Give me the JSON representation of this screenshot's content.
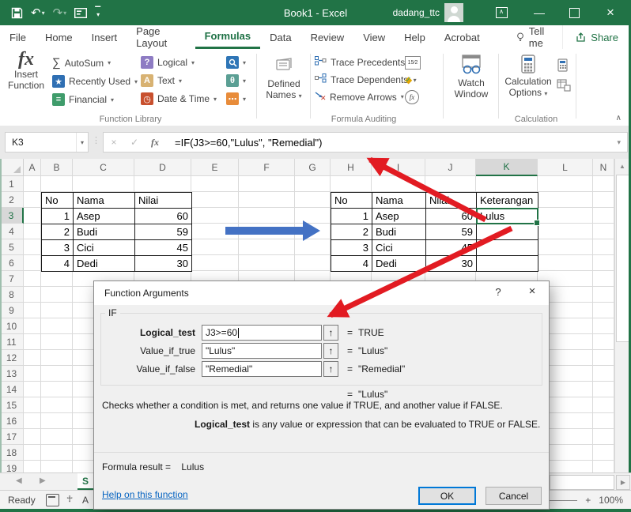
{
  "titlebar": {
    "title": "Book1 - Excel",
    "user": "dadang_ttc"
  },
  "icons": {
    "dropdown": "▾",
    "collapse_field": "↑",
    "collapse_ribbon": "∧",
    "close": "×",
    "minimize": "—",
    "help": "?",
    "undo": "↶",
    "redo": "↷",
    "sigma": "∑",
    "cancel_x": "×",
    "check": "✓",
    "fx": "fx",
    "up_scroll": "▲",
    "right_scroll": "▶",
    "left_nav": "◀",
    "right_nav": "▶",
    "plus": "+",
    "qat_chevron": "▾",
    "vdots": "⋮"
  },
  "tabs": {
    "items": [
      "File",
      "Home",
      "Insert",
      "Page Layout",
      "Formulas",
      "Data",
      "Review",
      "View",
      "Help",
      "Acrobat"
    ],
    "active": "Formulas",
    "tell_me": "Tell me",
    "share": "Share"
  },
  "ribbon": {
    "insert_function": "Insert Function",
    "autosum": "AutoSum",
    "recently_used": "Recently Used",
    "financial": "Financial",
    "logical": "Logical",
    "text": "Text",
    "date_time": "Date & Time",
    "defined_names": "Defined Names",
    "trace_precedents": "Trace Precedents",
    "trace_dependents": "Trace Dependents",
    "remove_arrows": "Remove Arrows",
    "watch_window": "Watch Window",
    "calculation_options": "Calculation Options",
    "labels": {
      "function_library": "Function Library",
      "formula_auditing": "Formula Auditing",
      "calculation": "Calculation"
    },
    "icon_colors": {
      "recently_used": "#2f6fb3",
      "financial": "#3f9c6b",
      "logical": "#8e7cc3",
      "text": "#d8b272",
      "date_time": "#c8502e",
      "lookup": "#2e75b6",
      "math_trig": "#5b9f94",
      "more_functions": "#e88c3a"
    }
  },
  "formula_bar": {
    "name_box": "K3",
    "formula": "=IF(J3>=60,\"Lulus\", \"Remedial\")"
  },
  "grid": {
    "col_letters": [
      "A",
      "B",
      "C",
      "D",
      "E",
      "F",
      "G",
      "H",
      "I",
      "J",
      "K",
      "L",
      "N"
    ],
    "visible_rows": 19,
    "selected_cell": "K3",
    "selected_col": "K",
    "selected_row": 3
  },
  "left_table": {
    "headers": [
      "No",
      "Nama",
      "Nilai"
    ],
    "rows": [
      [
        "1",
        "Asep",
        "60"
      ],
      [
        "2",
        "Budi",
        "59"
      ],
      [
        "3",
        "Cici",
        "45"
      ],
      [
        "4",
        "Dedi",
        "30"
      ]
    ]
  },
  "right_table": {
    "headers": [
      "No",
      "Nama",
      "Nilai",
      "Keterangan"
    ],
    "rows": [
      [
        "1",
        "Asep",
        "60",
        "Lulus"
      ],
      [
        "2",
        "Budi",
        "59",
        ""
      ],
      [
        "3",
        "Cici",
        "45",
        ""
      ],
      [
        "4",
        "Dedi",
        "30",
        ""
      ]
    ]
  },
  "dialog": {
    "title": "Function Arguments",
    "function_name": "IF",
    "eq": "=",
    "fields": [
      {
        "label": "Logical_test",
        "value": "J3>=60",
        "result": "TRUE"
      },
      {
        "label": "Value_if_true",
        "value": "\"Lulus\"",
        "result": "\"Lulus\""
      },
      {
        "label": "Value_if_false",
        "value": "\"Remedial\"",
        "result": "\"Remedial\""
      }
    ],
    "overall_result": "\"Lulus\"",
    "description": "Checks whether a condition is met, and returns one value if TRUE, and another value if FALSE.",
    "arg_help_label": "Logical_test",
    "arg_help_text": "  is any value or expression that can be evaluated to TRUE or FALSE.",
    "formula_result_label": "Formula result = ",
    "formula_result_value": "Lulus",
    "help_link": "Help on this function",
    "ok": "OK",
    "cancel": "Cancel"
  },
  "status_bar": {
    "ready": "Ready",
    "accessibility_fragment": "A",
    "zoom": "100%"
  },
  "sheet_tabs": {
    "visible_tab_fragment": "S"
  },
  "colors": {
    "excel_green": "#217346",
    "selection_green": "#1e7145",
    "red_arrow": "#e21b22",
    "blue_arrow": "#4472c4"
  }
}
